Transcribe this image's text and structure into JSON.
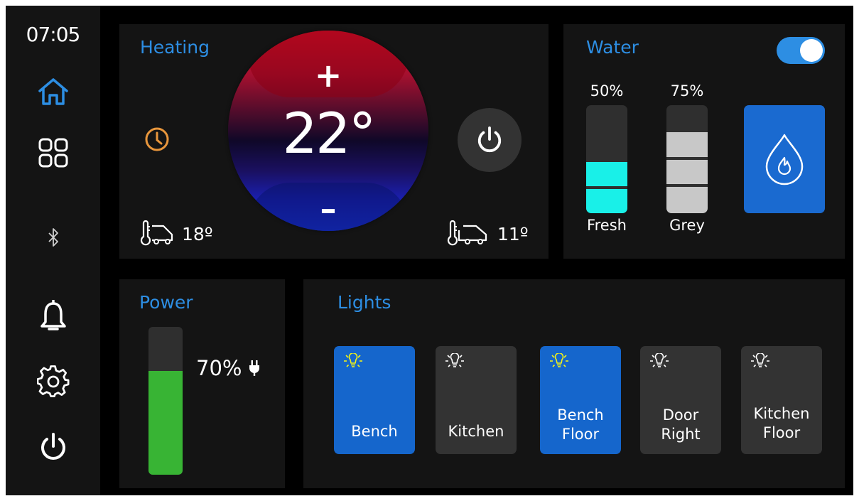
{
  "status": {
    "time": "07:05"
  },
  "sidebar": {
    "items": [
      {
        "name": "home",
        "icon": "home-icon",
        "active": true
      },
      {
        "name": "apps",
        "icon": "grid-icon"
      },
      {
        "name": "bluetooth",
        "icon": "bluetooth-icon"
      },
      {
        "name": "notifications",
        "icon": "bell-icon"
      },
      {
        "name": "settings",
        "icon": "gear-icon"
      },
      {
        "name": "power",
        "icon": "power-icon"
      }
    ]
  },
  "heating": {
    "title": "Heating",
    "setpoint": "22°",
    "increase_label": "+",
    "decrease_label": "–",
    "inside_temp": "18º",
    "outside_temp": "11º",
    "schedule_icon": "clock-icon",
    "power_icon": "power-icon"
  },
  "water": {
    "title": "Water",
    "enabled": true,
    "tanks": [
      {
        "label": "Fresh",
        "percent_text": "50%",
        "level": 0.5,
        "color": "#19f0e8"
      },
      {
        "label": "Grey",
        "percent_text": "75%",
        "level": 0.75,
        "color": "#c8c8c8"
      }
    ],
    "heater_icon": "water-flame-icon"
  },
  "power": {
    "title": "Power",
    "percent_text": "70%",
    "level": 0.7,
    "plug_icon": "plug-icon"
  },
  "lights": {
    "title": "Lights",
    "items": [
      {
        "label": "Bench",
        "on": true
      },
      {
        "label": "Kitchen",
        "on": false
      },
      {
        "label": "Bench\nFloor",
        "on": true
      },
      {
        "label": "Door\nRight",
        "on": false
      },
      {
        "label": "Kitchen\nFloor",
        "on": false
      }
    ]
  },
  "colors": {
    "accent": "#2d8ee3",
    "panel": "#141414",
    "light_on": "#1566cc",
    "bulb_on": "#f1f11a",
    "clock_icon": "#e8963c",
    "battery": "#38b434"
  }
}
